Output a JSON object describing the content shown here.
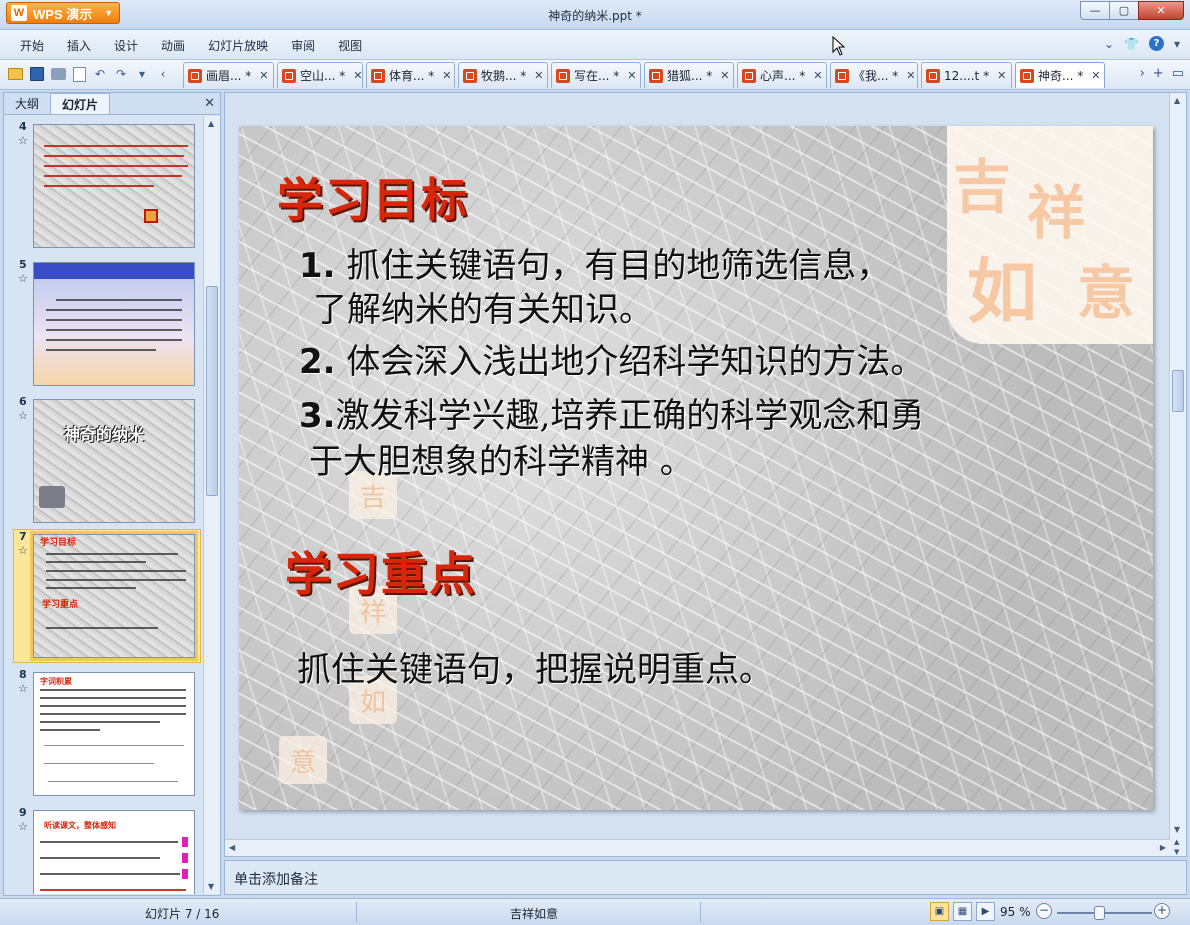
{
  "app": {
    "name": "WPS 演示",
    "logo": "W"
  },
  "window": {
    "title": "神奇的纳米.ppt *",
    "minimize": "—",
    "maximize": "▢",
    "close": "✕"
  },
  "menu": [
    "开始",
    "插入",
    "设计",
    "动画",
    "幻灯片放映",
    "审阅",
    "视图"
  ],
  "tabs": [
    {
      "label": "画眉...",
      "dirty": "*"
    },
    {
      "label": "空山...",
      "dirty": "*"
    },
    {
      "label": "体育...",
      "dirty": "*"
    },
    {
      "label": "牧鹅...",
      "dirty": "*"
    },
    {
      "label": "写在...",
      "dirty": "*"
    },
    {
      "label": "猎狐...",
      "dirty": "*"
    },
    {
      "label": "心声...",
      "dirty": "*"
    },
    {
      "label": "《我...",
      "dirty": "*"
    },
    {
      "label": "12....t",
      "dirty": "*"
    },
    {
      "label": "神奇...",
      "dirty": "*"
    }
  ],
  "panel": {
    "tab_outline": "大纲",
    "tab_slides": "幻灯片",
    "close": "✕"
  },
  "thumbs": [
    {
      "num": "4",
      "star": "☆"
    },
    {
      "num": "5",
      "star": "☆"
    },
    {
      "num": "6",
      "star": "☆",
      "title": "神奇的纳米"
    },
    {
      "num": "7",
      "star": "☆",
      "h1": "学习目标",
      "h2": "学习重点"
    },
    {
      "num": "8",
      "star": "☆",
      "h1": "字词积累"
    },
    {
      "num": "9",
      "star": "☆",
      "h1": "听读课文，整体感知"
    }
  ],
  "slide": {
    "heading1": "学习目标",
    "item1_num": "1.",
    "item1_line1": " 抓住关键语句，有目的地筛选信息，",
    "item1_line2": "了解纳米的有关知识。",
    "item2_num": "2.",
    "item2_text": " 体会深入浅出地介绍科学知识的方法。",
    "item3_num": "3.",
    "item3_line1": "激发科学兴趣,培养正确的科学观念和勇",
    "item3_line2": "于大胆想象的科学精神 。",
    "heading2": "学习重点",
    "focus": "抓住关键语句，把握说明重点。",
    "seal_chars": [
      "吉",
      "祥",
      "如",
      "意"
    ]
  },
  "notes_placeholder": "单击添加备注",
  "status": {
    "slide_counter": "幻灯片 7 / 16",
    "theme": "吉祥如意",
    "zoom": "95 %",
    "zoom_level": 0.5
  }
}
